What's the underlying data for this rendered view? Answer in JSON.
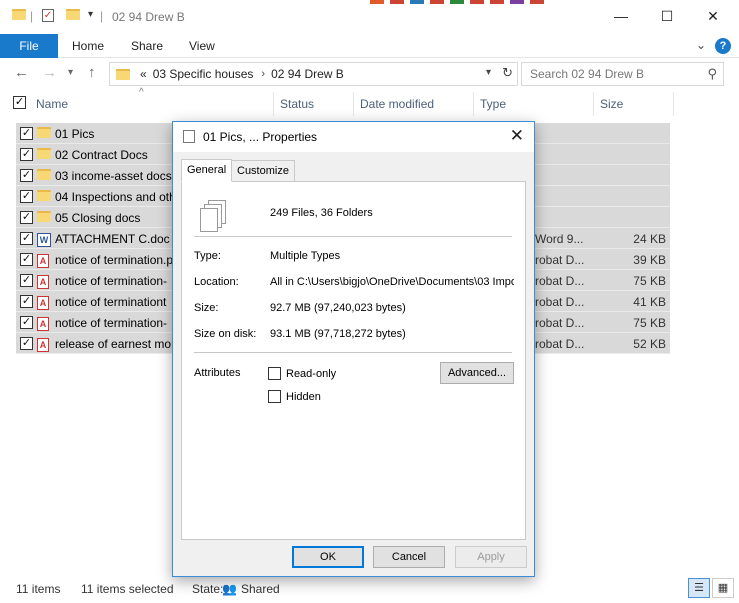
{
  "window": {
    "title": "02 94 Drew B",
    "controls": {
      "minimize": "—",
      "maximize": "☐",
      "close": "✕"
    }
  },
  "ribbon": {
    "tabs": [
      "File",
      "Home",
      "Share",
      "View"
    ],
    "expand": "⌄",
    "help": "?"
  },
  "address": {
    "prefix": "«",
    "crumbs": [
      "03 Specific houses",
      "02 94 Drew B"
    ],
    "search_placeholder": "Search 02 94 Drew B"
  },
  "columns": [
    "Name",
    "Status",
    "Date modified",
    "Type",
    "Size"
  ],
  "files": [
    {
      "name": "01 Pics",
      "icon": "folder",
      "type": "",
      "size": ""
    },
    {
      "name": "02 Contract Docs",
      "icon": "folder",
      "type": "",
      "size": ""
    },
    {
      "name": "03 income-asset docs",
      "icon": "folder",
      "type": "",
      "size": ""
    },
    {
      "name": "04 Inspections and oth",
      "icon": "folder",
      "type": "",
      "size": ""
    },
    {
      "name": "05 Closing docs",
      "icon": "folder",
      "type": "",
      "size": ""
    },
    {
      "name": "ATTACHMENT C.doc",
      "icon": "word",
      "type": "Word 9...",
      "size": "24 KB"
    },
    {
      "name": "notice of termination.p",
      "icon": "pdf",
      "type": "robat D...",
      "size": "39 KB"
    },
    {
      "name": "notice of termination-",
      "icon": "pdf",
      "type": "robat D...",
      "size": "75 KB"
    },
    {
      "name": "notice of terminationt",
      "icon": "pdf",
      "type": "robat D...",
      "size": "41 KB"
    },
    {
      "name": "notice of termination-",
      "icon": "pdf",
      "type": "robat D...",
      "size": "75 KB"
    },
    {
      "name": "release of earnest mon",
      "icon": "pdf",
      "type": "robat D...",
      "size": "52 KB"
    }
  ],
  "status": {
    "count": "11 items",
    "selected": "11 items selected",
    "state_label": "State:",
    "state_value": "Shared"
  },
  "dialog": {
    "title": "01 Pics, ... Properties",
    "tabs": [
      "General",
      "Customize"
    ],
    "summary": "249 Files, 36 Folders",
    "type_label": "Type:",
    "type_value": "Multiple Types",
    "location_label": "Location:",
    "location_value": "All in C:\\Users\\bigjo\\OneDrive\\Documents\\03 Impo",
    "size_label": "Size:",
    "size_value": "92.7 MB (97,240,023 bytes)",
    "size_disk_label": "Size on disk:",
    "size_disk_value": "93.1 MB (97,718,272 bytes)",
    "attributes_label": "Attributes",
    "readonly_label": "Read-only",
    "hidden_label": "Hidden",
    "advanced_label": "Advanced...",
    "ok_label": "OK",
    "cancel_label": "Cancel",
    "apply_label": "Apply"
  }
}
